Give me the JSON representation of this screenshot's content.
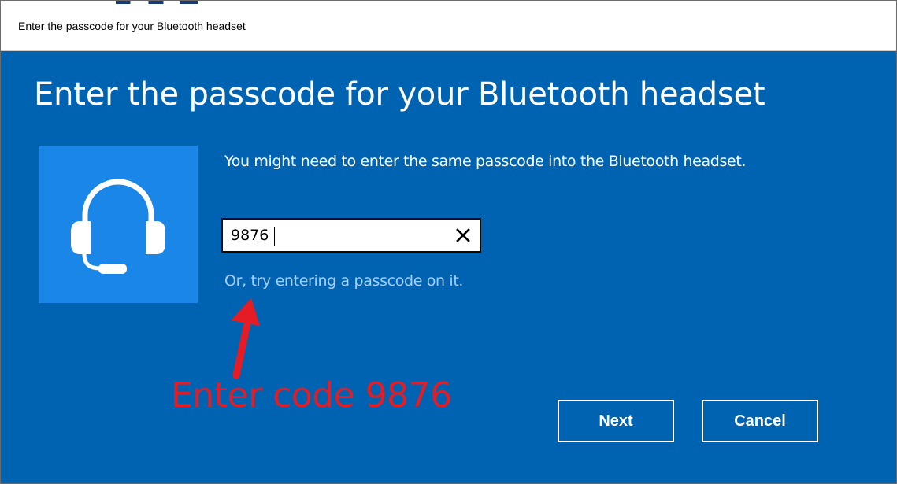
{
  "window": {
    "title": "Enter the passcode for your Bluetooth headset"
  },
  "dialog": {
    "heading": "Enter the passcode for your Bluetooth headset",
    "device_icon": "headset-icon",
    "description": "You might need to enter the same passcode into the Bluetooth headset.",
    "passcode_value": "9876",
    "clear_icon": "close-icon",
    "alt_link": "Or, try entering a passcode on it."
  },
  "annotation": {
    "text": "Enter code 9876",
    "color": "#e51c23"
  },
  "buttons": {
    "next_label": "Next",
    "cancel_label": "Cancel"
  },
  "colors": {
    "background": "#0063b1",
    "tile": "#1a86e8",
    "link": "#a8cdf2"
  }
}
